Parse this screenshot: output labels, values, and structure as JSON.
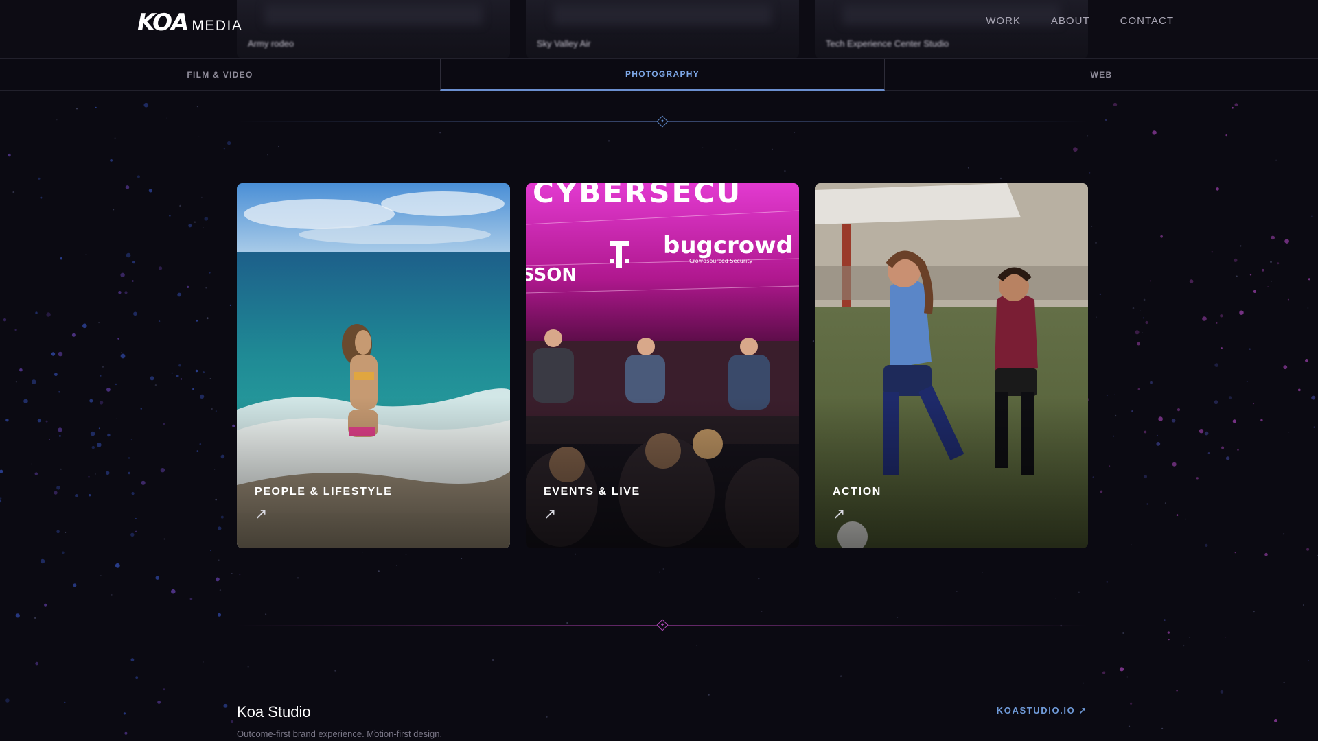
{
  "header": {
    "logo_mark": "KOA",
    "logo_text": "MEDIA",
    "nav": [
      "WORK",
      "ABOUT",
      "CONTACT"
    ],
    "peek_cards": [
      "Army rodeo",
      "Sky Valley Air",
      "Tech Experience Center Studio"
    ]
  },
  "tabs": [
    {
      "label": "FILM & VIDEO",
      "active": false
    },
    {
      "label": "PHOTOGRAPHY",
      "active": true
    },
    {
      "label": "WEB",
      "active": false
    }
  ],
  "cards": [
    {
      "label": "PEOPLE & LIFESTYLE",
      "icon": "arrow-up-right-icon"
    },
    {
      "label": "EVENTS & LIVE",
      "icon": "arrow-up-right-icon"
    },
    {
      "label": "ACTION",
      "icon": "arrow-up-right-icon"
    }
  ],
  "event_photo": {
    "banner_text": "CYBERSECU",
    "sponsor": "bugcrowd",
    "sponsor_sub": "Crowdsourced Security",
    "brand_fragment": "SSON"
  },
  "footer": {
    "studio_name": "Koa Studio",
    "studio_tagline": "Outcome-first brand experience. Motion-first design.",
    "studio_link": "KOASTUDIO.IO ↗"
  },
  "colors": {
    "background": "#0b0a12",
    "accent_blue": "#7ea8e8",
    "accent_pink": "#c34ac9"
  }
}
